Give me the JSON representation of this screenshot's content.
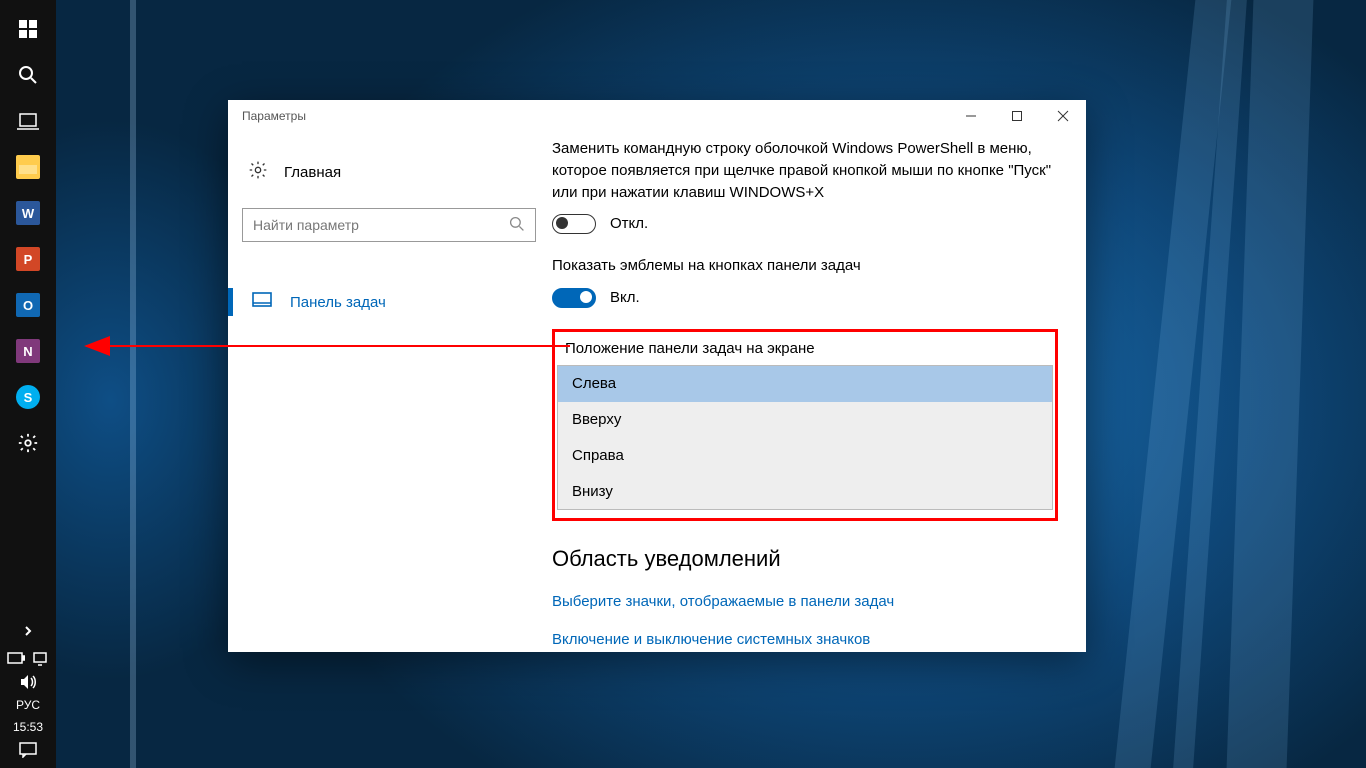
{
  "taskbar": {
    "apps": [
      "W",
      "P",
      "O",
      "N",
      "S"
    ],
    "lang": "РУС",
    "clock": "15:53"
  },
  "window": {
    "title": "Параметры",
    "home": "Главная",
    "search_placeholder": "Найти параметр",
    "nav_item": "Панель задач"
  },
  "content": {
    "powershell_text": "Заменить командную строку оболочкой Windows PowerShell в меню, которое появляется при щелчке правой кнопкой мыши по кнопке \"Пуск\" или при нажатии клавиш WINDOWS+X",
    "off_label": "Откл.",
    "badges_text": "Показать эмблемы на кнопках панели задач",
    "on_label": "Вкл.",
    "position_label": "Положение панели задач на экране",
    "options": [
      "Слева",
      "Вверху",
      "Справа",
      "Внизу"
    ],
    "notify_heading": "Область уведомлений",
    "link1": "Выберите значки, отображаемые в панели задач",
    "link2": "Включение и выключение системных значков"
  }
}
